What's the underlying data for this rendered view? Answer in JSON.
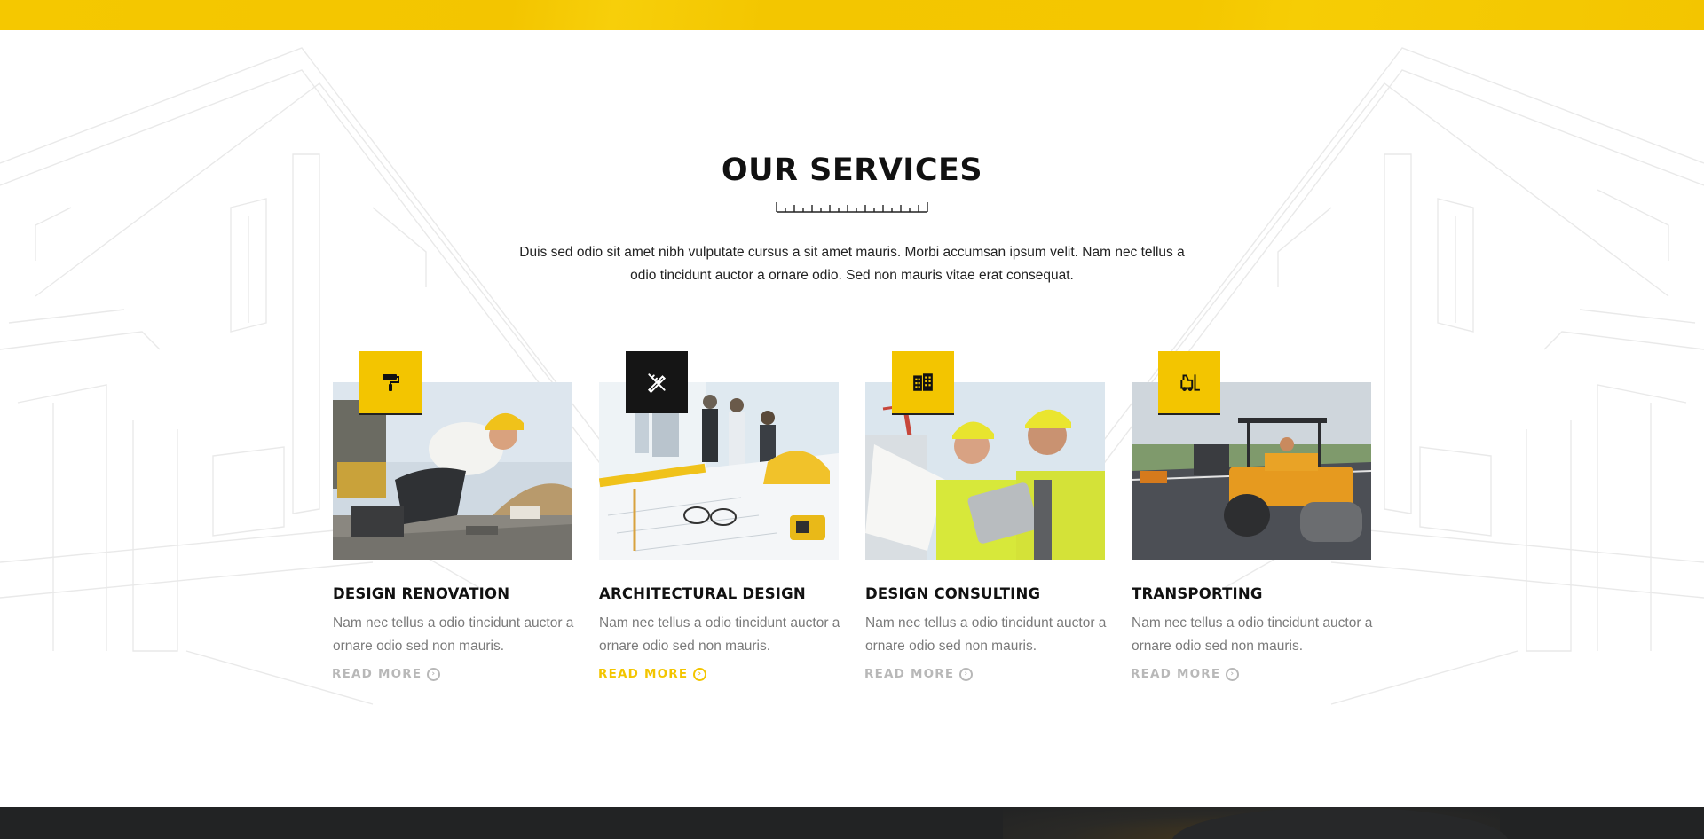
{
  "colors": {
    "accent": "#f3c500",
    "dark": "#151515",
    "footer": "#222324",
    "muted_text": "#7a7a7a",
    "read_more_inactive": "#b8b8b8"
  },
  "section": {
    "title": "OUR SERVICES",
    "intro": "Duis sed odio sit amet nibh vulputate cursus a sit amet mauris. Morbi accumsan ipsum velit. Nam nec tellus a odio tincidunt auctor a ornare odio. Sed non  mauris vitae erat consequat."
  },
  "services": [
    {
      "title": "DESIGN RENOVATION",
      "description": "Nam nec tellus a odio tincidunt auctor a ornare odio sed non mauris.",
      "read_more": "READ MORE",
      "icon": "paint-roller-icon",
      "active": false
    },
    {
      "title": "ARCHITECTURAL DESIGN",
      "description": "Nam nec tellus a odio tincidunt auctor a ornare odio sed non mauris.",
      "read_more": "READ MORE",
      "icon": "pencil-ruler-icon",
      "active": true
    },
    {
      "title": "DESIGN CONSULTING",
      "description": "Nam nec tellus a odio tincidunt auctor a ornare odio sed non mauris.",
      "read_more": "READ MORE",
      "icon": "building-icon",
      "active": false
    },
    {
      "title": "TRANSPORTING",
      "description": "Nam nec tellus a odio tincidunt auctor a ornare odio sed non mauris.",
      "read_more": "READ MORE",
      "icon": "forklift-icon",
      "active": false
    }
  ]
}
